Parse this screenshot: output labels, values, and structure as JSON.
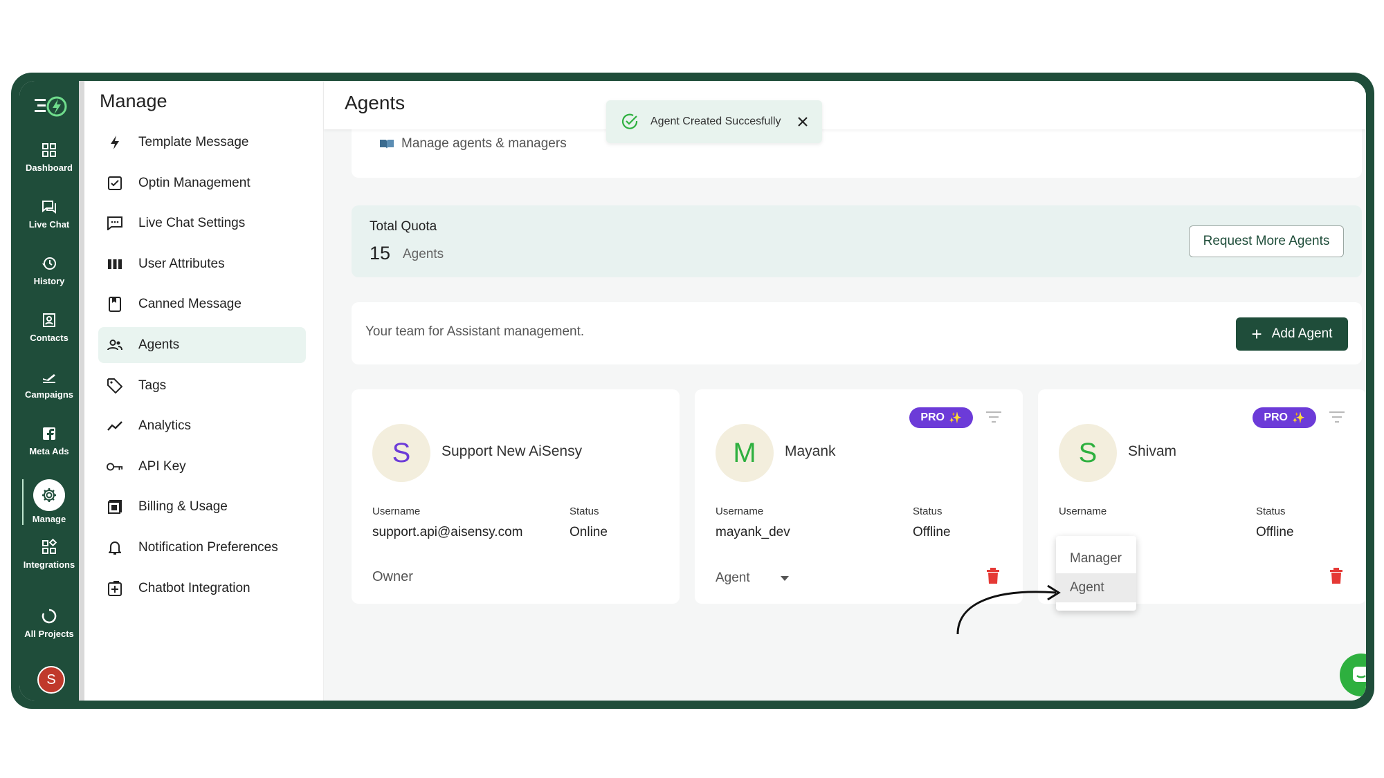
{
  "rail": {
    "items": [
      {
        "label": "Dashboard",
        "icon": "dashboard-icon"
      },
      {
        "label": "Live Chat",
        "icon": "live-chat-icon"
      },
      {
        "label": "History",
        "icon": "history-icon"
      },
      {
        "label": "Contacts",
        "icon": "contacts-icon"
      },
      {
        "label": "Campaigns",
        "icon": "campaigns-icon"
      },
      {
        "label": "Meta Ads",
        "icon": "meta-ads-icon"
      },
      {
        "label": "Manage",
        "icon": "gear-icon",
        "active": true
      },
      {
        "label": "Integrations",
        "icon": "integrations-icon"
      },
      {
        "label": "All Projects",
        "icon": "all-projects-icon"
      }
    ],
    "avatar_initial": "S"
  },
  "manage": {
    "title": "Manage",
    "items": [
      {
        "label": "Template Message",
        "icon": "lightning-icon"
      },
      {
        "label": "Optin Management",
        "icon": "checkbox-icon"
      },
      {
        "label": "Live Chat Settings",
        "icon": "chat-settings-icon"
      },
      {
        "label": "User Attributes",
        "icon": "columns-icon"
      },
      {
        "label": "Canned Message",
        "icon": "bookmark-icon"
      },
      {
        "label": "Agents",
        "icon": "agents-icon",
        "active": true
      },
      {
        "label": "Tags",
        "icon": "tag-icon"
      },
      {
        "label": "Analytics",
        "icon": "analytics-icon"
      },
      {
        "label": "API Key",
        "icon": "key-icon"
      },
      {
        "label": "Billing & Usage",
        "icon": "billing-icon"
      },
      {
        "label": "Notification Preferences",
        "icon": "bell-icon"
      },
      {
        "label": "Chatbot Integration",
        "icon": "plus-box-icon"
      }
    ]
  },
  "main": {
    "title": "Agents",
    "intro_link": "Manage agents & managers",
    "toast": {
      "text": "Agent Created Succesfully"
    },
    "quota": {
      "label": "Total Quota",
      "value": "15",
      "unit": "Agents",
      "request_button": "Request More Agents"
    },
    "team": {
      "text": "Your team for Assistant management.",
      "add_button": "Add Agent"
    },
    "agents": [
      {
        "initial": "S",
        "initial_color": "#6c3bd8",
        "name": "Support New AiSensy",
        "username_label": "Username",
        "username": "support.api@aisensy.com",
        "status_label": "Status",
        "status": "Online",
        "role": "Owner",
        "pro": false
      },
      {
        "initial": "M",
        "initial_color": "#2eb03f",
        "name": "Mayank",
        "username_label": "Username",
        "username": "mayank_dev",
        "status_label": "Status",
        "status": "Offline",
        "role": "Agent",
        "pro": true,
        "pro_label": "PRO"
      },
      {
        "initial": "S",
        "initial_color": "#2eb03f",
        "name": "Shivam",
        "username_label": "Username",
        "username": "",
        "status_label": "Status",
        "status": "Offline",
        "pro": true,
        "pro_label": "PRO"
      }
    ],
    "role_dropdown": {
      "options": [
        "Manager",
        "Agent"
      ],
      "highlighted": "Agent"
    }
  },
  "colors": {
    "brand": "#1f4d3a",
    "accent_light": "#e8f2f0",
    "pro": "#6c3bd8",
    "danger": "#e53935",
    "fab": "#2eb03f"
  }
}
